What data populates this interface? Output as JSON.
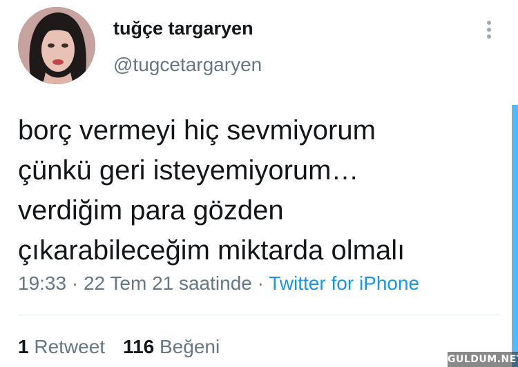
{
  "tweet": {
    "display_name": "tuğçe targaryen",
    "handle": "@tugcetargaryen",
    "text_lines": [
      "borç vermeyi hiç sevmiyorum",
      "çünkü geri isteyemiyorum…",
      "verdiğim para gözden",
      "çıkarabileceğim miktarda olmalı"
    ],
    "time": "19:33",
    "date": "22 Tem 21 saatinde",
    "separator": " · ",
    "source": "Twitter for iPhone"
  },
  "stats": {
    "retweet_count": "1",
    "retweet_label": "Retweet",
    "like_count": "116",
    "like_label": "Beğeni"
  },
  "icons": {
    "more": "vertical-dots-icon"
  },
  "watermark": "GULDUM.NET",
  "colors": {
    "link": "#1b95e0",
    "secondary_text": "#657786",
    "primary_text": "#14171a"
  }
}
